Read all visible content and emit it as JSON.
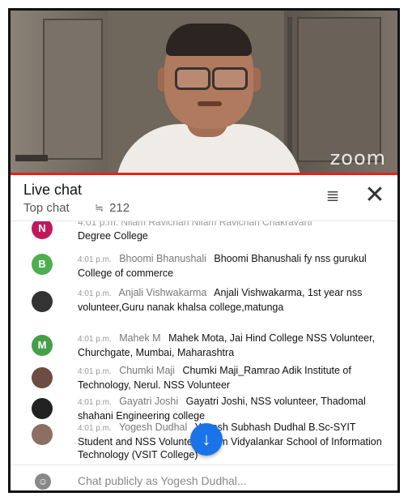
{
  "video": {
    "watermark": "zoom"
  },
  "chat": {
    "title": "Live chat",
    "mode": "Top chat",
    "viewer_count": "212",
    "filter_icon": "filter-sliders-icon",
    "close_icon": "close-icon"
  },
  "messages": [
    {
      "clipped_header": "4:01 p.m. Nilam Ravichan Nilam Ravichan Chakravarti",
      "text": "Degree College",
      "avatar_letter": "N",
      "avatar_color": "#c2185b"
    },
    {
      "time": "4:01 p.m.",
      "author": "Bhoomi Bhanushali",
      "text": "Bhoomi Bhanushali fy nss gurukul College of commerce",
      "avatar_letter": "B",
      "avatar_color": "#4caf50"
    },
    {
      "time": "4:01 p.m.",
      "author": "Anjali Vishwakarma",
      "text": "Anjali Vishwakarma, 1st year nss volunteer,Guru nanak khalsa college,matunga",
      "avatar_letter": "",
      "avatar_color": "#333333"
    },
    {
      "time": "4:01 p.m.",
      "author": "Mahek M",
      "text": "Mahek Mota, Jai Hind College NSS Volunteer, Churchgate, Mumbai, Maharashtra",
      "avatar_letter": "M",
      "avatar_color": "#43a047"
    },
    {
      "time": "4:01 p.m.",
      "author": "Chumki Maji",
      "text": "Chumki Maji_Ramrao Adik Institute of Technology, Nerul. NSS Volunteer",
      "avatar_letter": "",
      "avatar_color": "#6d4c41"
    },
    {
      "time": "4:01 p.m.",
      "author": "Gayatri Joshi",
      "text": "Gayatri Joshi, NSS volunteer, Thadomal shahani Engineering college",
      "avatar_letter": "",
      "avatar_color": "#222222"
    },
    {
      "time": "4:01 p.m.",
      "author": "Yogesh Dudhal",
      "text": "Yogesh Subhash Dudhal B.Sc-SYIT Student and NSS Volunteer From Vidyalankar School of Information Technology (VSIT College)",
      "avatar_letter": "",
      "avatar_color": "#8d6e63"
    }
  ],
  "input": {
    "placeholder": "Chat publicly as Yogesh Dudhal...",
    "emoji_icon": "emoji-icon"
  },
  "scroll_button": {
    "icon": "arrow-down-icon",
    "symbol": "↓"
  }
}
